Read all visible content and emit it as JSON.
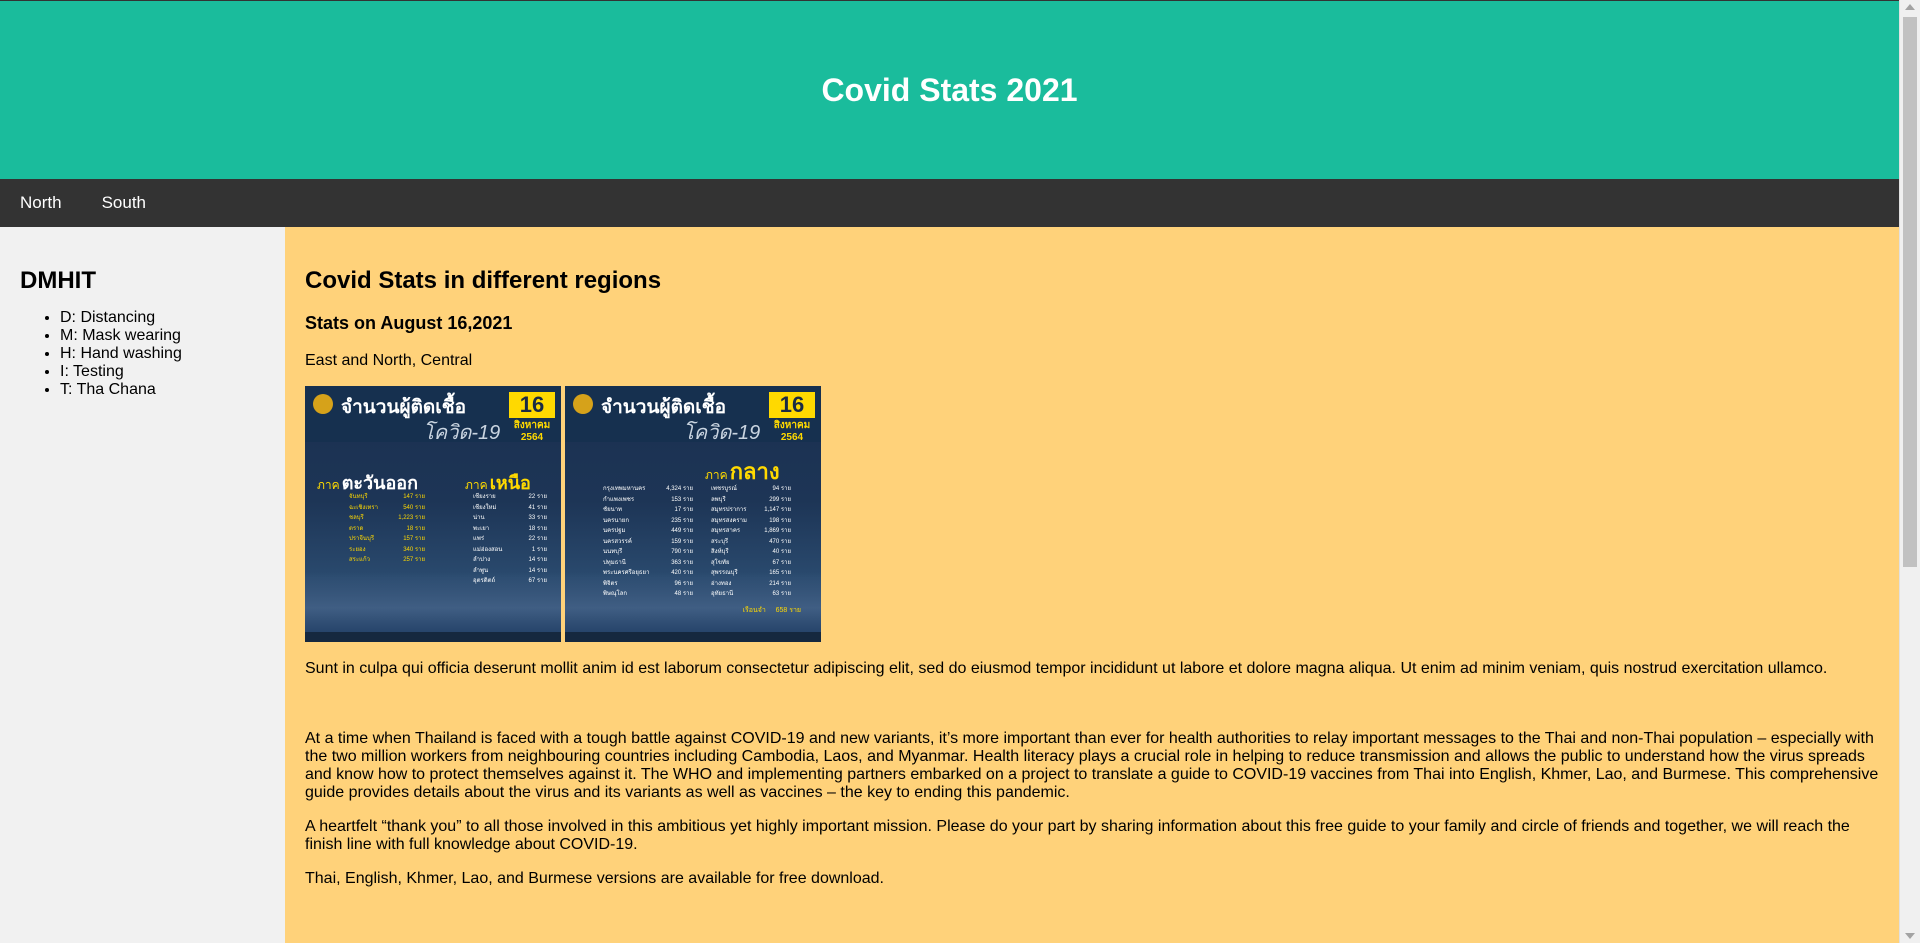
{
  "header": {
    "title": "Covid Stats 2021"
  },
  "nav": {
    "items": [
      {
        "label": "North"
      },
      {
        "label": "South"
      }
    ]
  },
  "sidebar": {
    "title": "DMHIT",
    "items": [
      {
        "label": "D: Distancing"
      },
      {
        "label": "M: Mask wearing"
      },
      {
        "label": "H: Hand washing"
      },
      {
        "label": "I: Testing"
      },
      {
        "label": "T: Tha Chana"
      }
    ]
  },
  "main": {
    "title": "Covid Stats in different regions",
    "date_heading": "Stats on August 16,2021",
    "regions_caption": "East and North, Central",
    "posters": [
      {
        "heading": "จำนวนผู้ติดเชื้อ",
        "subheading": "โควิด-19",
        "day": "16",
        "month": "สิงหาคม",
        "year": "2564",
        "region_left_prefix": "ภาค",
        "region_left": "ตะวันออก",
        "region_right_prefix": "ภาค",
        "region_right": "เหนือ",
        "left_rows": [
          [
            "จันทบุรี",
            "147 ราย"
          ],
          [
            "ฉะเชิงเทรา",
            "540 ราย"
          ],
          [
            "ชลบุรี",
            "1,223 ราย"
          ],
          [
            "ตราด",
            "18 ราย"
          ],
          [
            "ปราจีนบุรี",
            "157 ราย"
          ],
          [
            "ระยอง",
            "340 ราย"
          ],
          [
            "สระแก้ว",
            "257 ราย"
          ]
        ],
        "right_rows": [
          [
            "เชียงราย",
            "22 ราย"
          ],
          [
            "เชียงใหม่",
            "41 ราย"
          ],
          [
            "น่าน",
            "33 ราย"
          ],
          [
            "พะเยา",
            "18 ราย"
          ],
          [
            "แพร่",
            "22 ราย"
          ],
          [
            "แม่ฮ่องสอน",
            "1 ราย"
          ],
          [
            "ลำปาง",
            "14 ราย"
          ],
          [
            "ลำพูน",
            "14 ราย"
          ],
          [
            "อุตรดิตถ์",
            "67 ราย"
          ]
        ]
      },
      {
        "heading": "จำนวนผู้ติดเชื้อ",
        "subheading": "โควิด-19",
        "day": "16",
        "month": "สิงหาคม",
        "year": "2564",
        "region_prefix": "ภาค",
        "region": "กลาง",
        "left_rows": [
          [
            "กรุงเทพมหานคร",
            "4,324 ราย"
          ],
          [
            "กำแพงเพชร",
            "153 ราย"
          ],
          [
            "ชัยนาท",
            "17 ราย"
          ],
          [
            "นครนายก",
            "235 ราย"
          ],
          [
            "นครปฐม",
            "449 ราย"
          ],
          [
            "นครสวรรค์",
            "159 ราย"
          ],
          [
            "นนทบุรี",
            "790 ราย"
          ],
          [
            "ปทุมธานี",
            "363 ราย"
          ],
          [
            "พระนครศรีอยุธยา",
            "420 ราย"
          ],
          [
            "พิจิตร",
            "96 ราย"
          ],
          [
            "พิษณุโลก",
            "48 ราย"
          ]
        ],
        "right_rows": [
          [
            "เพชรบูรณ์",
            "94 ราย"
          ],
          [
            "ลพบุรี",
            "299 ราย"
          ],
          [
            "สมุทรปราการ",
            "1,147 ราย"
          ],
          [
            "สมุทรสงคราม",
            "198 ราย"
          ],
          [
            "สมุทรสาคร",
            "1,869 ราย"
          ],
          [
            "สระบุรี",
            "470 ราย"
          ],
          [
            "สิงห์บุรี",
            "40 ราย"
          ],
          [
            "สุโขทัย",
            "67 ราย"
          ],
          [
            "สุพรรณบุรี",
            "165 ราย"
          ],
          [
            "อ่างทอง",
            "214 ราย"
          ],
          [
            "อุทัยธานี",
            "63 ราย"
          ]
        ],
        "total_label": "เรือนจำ",
        "total_value": "658 ราย"
      }
    ],
    "para1": "Sunt in culpa qui officia deserunt mollit anim id est laborum consectetur adipiscing elit, sed do eiusmod tempor incididunt ut labore et dolore magna aliqua. Ut enim ad minim veniam, quis nostrud exercitation ullamco.",
    "para2": "At a time when Thailand is faced with a tough battle against COVID-19 and new variants, it’s more important than ever for health authorities to relay important messages to the Thai and non-Thai population – especially with the two million workers from neighbouring countries including Cambodia, Laos, and Myanmar. Health literacy plays a crucial role in helping to reduce transmission and allows the public to understand how the virus spreads and know how to protect themselves against it. The WHO and implementing partners embarked on a project to translate a guide to COVID-19 vaccines from Thai into English, Khmer, Lao, and Burmese. This comprehensive guide provides details about the virus and its variants as well as vaccines – the key to ending this pandemic.",
    "para3": "A heartfelt “thank you” to all those involved in this ambitious yet highly important mission. Please do your part by sharing information about this free guide to your family and circle of friends and together, we will reach the finish line with full knowledge about COVID-19.",
    "para4": "Thai, English, Khmer, Lao, and Burmese versions are available for free download."
  },
  "colors": {
    "header": "#1abc9c",
    "nav": "#333333",
    "sidebar": "#f1f1f1",
    "main": "#ffd27a"
  }
}
